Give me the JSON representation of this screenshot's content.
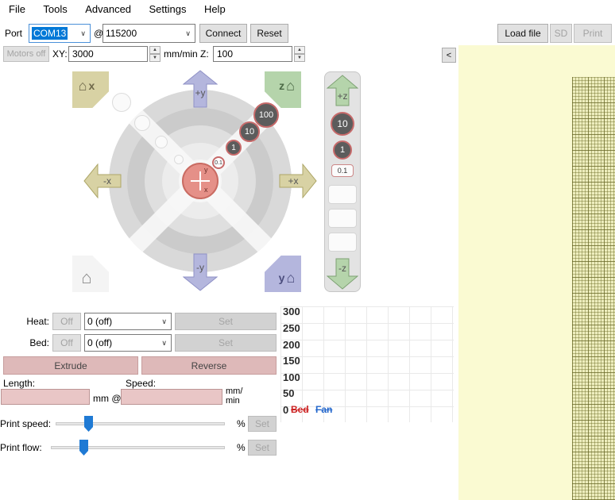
{
  "menu_items": [
    "File",
    "Tools",
    "Advanced",
    "Settings",
    "Help"
  ],
  "toolbar": {
    "port_label": "Port",
    "port_value": "COM13",
    "at_label": "@",
    "baud_value": "115200",
    "connect": "Connect",
    "reset": "Reset",
    "load_file": "Load file",
    "sd": "SD",
    "print": "Print"
  },
  "motion_row": {
    "motors_off": "Motors off",
    "xy_label": "XY:",
    "xy_speed": "3000",
    "z_label": "mm/min Z:",
    "z_speed": "100",
    "collapse": "<"
  },
  "jog": {
    "home_x_label": "x",
    "home_z_label": "z",
    "home_y_label": "y",
    "plus_y": "+y",
    "minus_y": "-y",
    "plus_x": "+x",
    "minus_x": "-x",
    "center_x": "x",
    "center_y": "y",
    "distances": [
      "100",
      "10",
      "1",
      "0.1"
    ]
  },
  "z_control": {
    "plus_z": "+z",
    "minus_z": "-z",
    "steps": [
      "10",
      "1",
      "0.1"
    ]
  },
  "temps": {
    "heat_label": "Heat:",
    "bed_label": "Bed:",
    "off": "Off",
    "heat_preset": "0 (off)",
    "bed_preset": "0 (off)",
    "set": "Set"
  },
  "extrusion": {
    "extrude": "Extrude",
    "reverse": "Reverse",
    "length_label": "Length:",
    "speed_label": "Speed:",
    "mm_at": "mm @",
    "mm_min_1": "mm/",
    "mm_min_2": "min"
  },
  "speed_controls": {
    "print_speed_label": "Print speed:",
    "print_flow_label": "Print flow:",
    "percent": "%",
    "set": "Set"
  },
  "temp_graph": {
    "yticks": [
      "300",
      "250",
      "200",
      "150",
      "100",
      "50",
      "0"
    ],
    "legend": [
      {
        "label": "Bed",
        "color": "#cc2222"
      },
      {
        "label": "Fan",
        "color": "#2266cc"
      }
    ]
  },
  "icons": {
    "house": "⌂",
    "spin_up": "▲",
    "spin_down": "▼",
    "dropdown": "∨"
  },
  "colors": {
    "accent_blue": "#0078d7",
    "panel_yellow": "#fafad2",
    "x_axis": "#d8d2a4",
    "y_axis": "#b4b6dd",
    "z_axis": "#b5d4ab",
    "extrude_pink": "#deb9b9"
  }
}
